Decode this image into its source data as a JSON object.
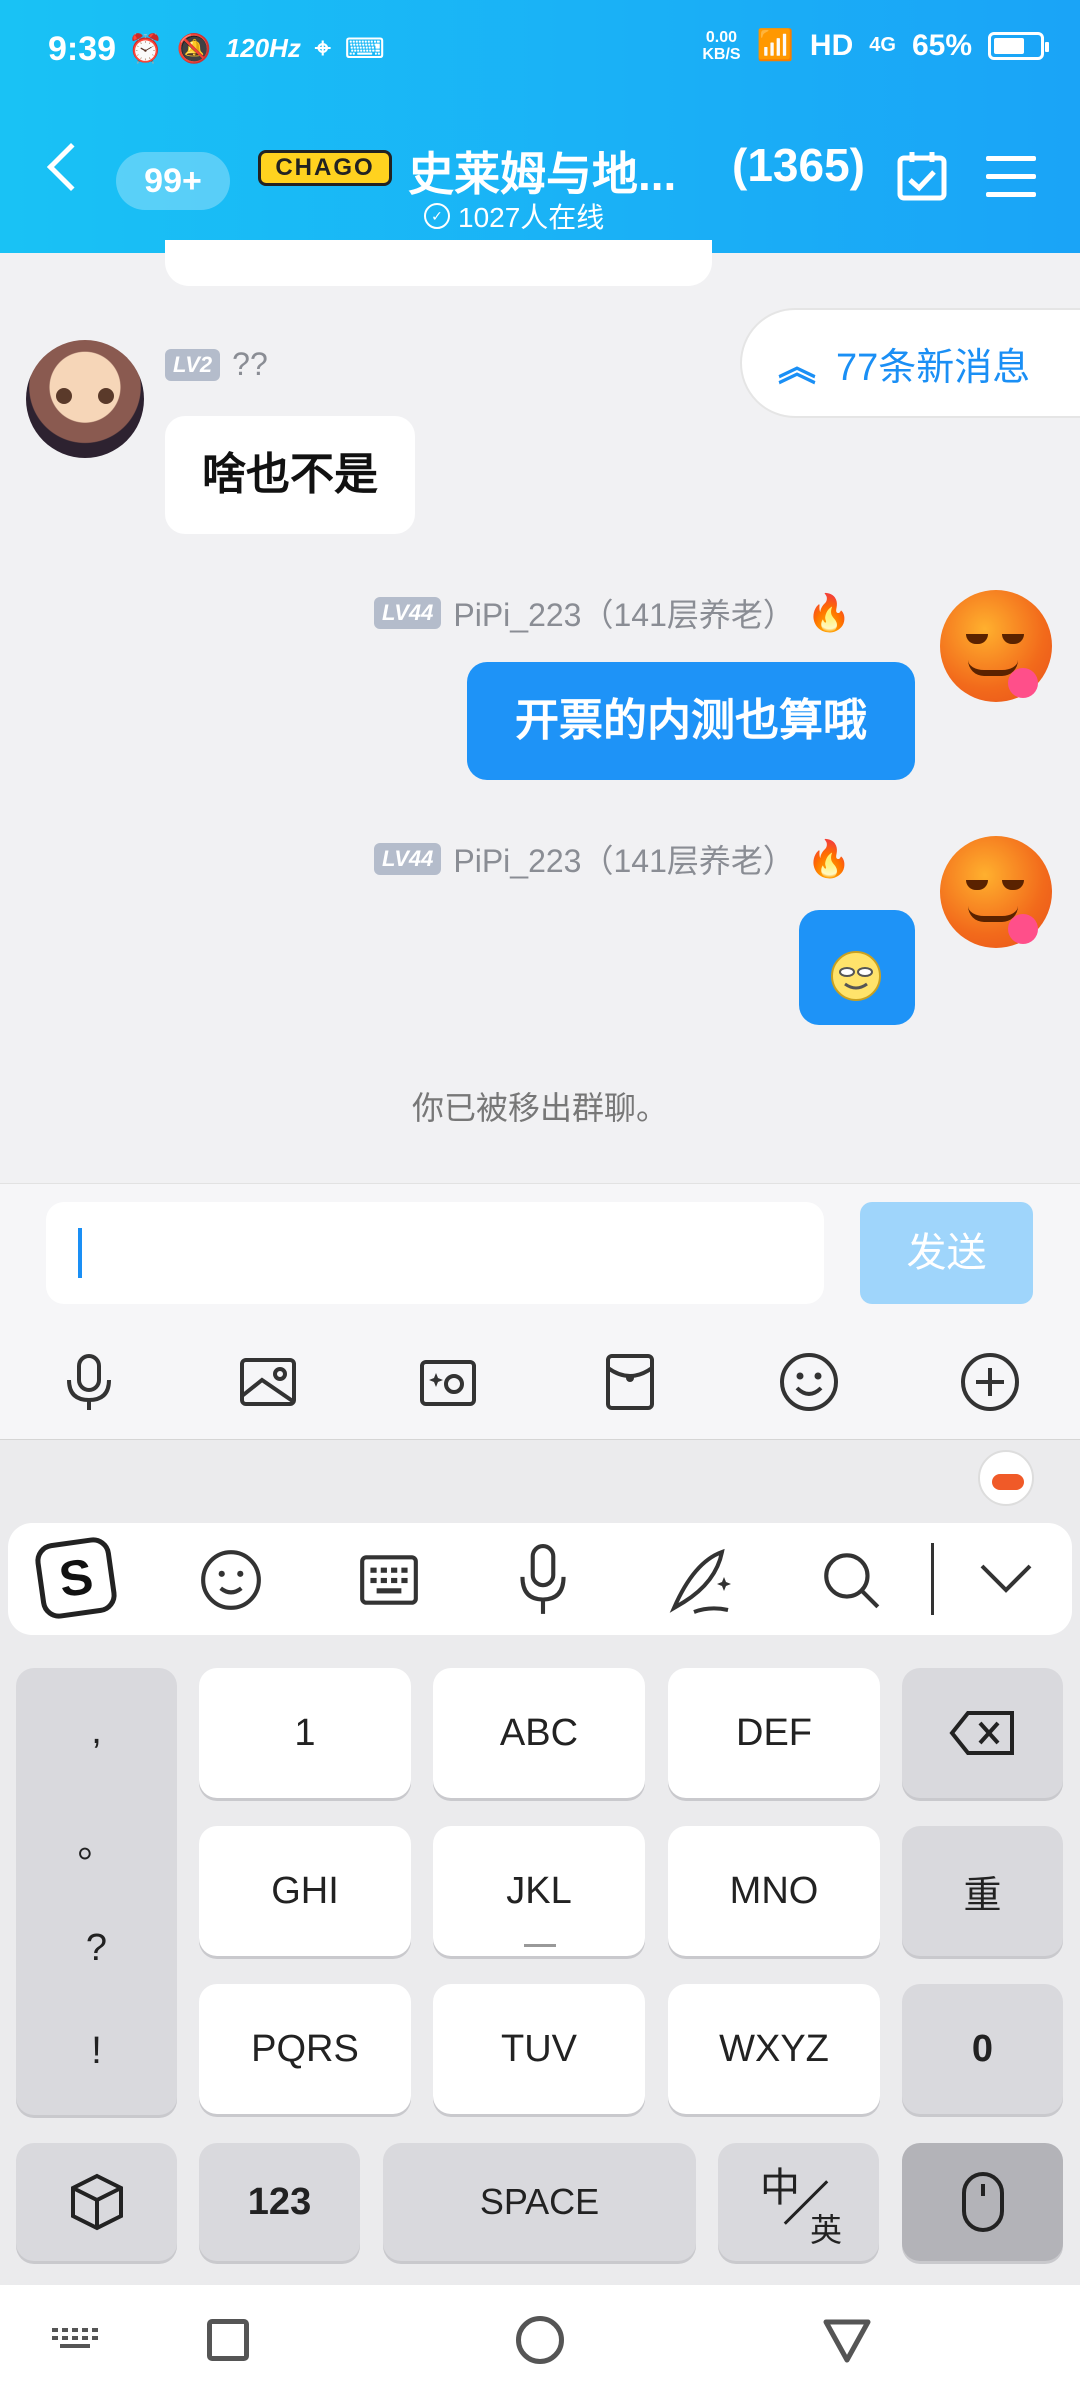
{
  "status": {
    "time": "9:39",
    "refresh": "120Hz",
    "speed_top": "0.00",
    "speed_bottom": "KB/S",
    "network": "HD",
    "signal": "4G",
    "battery": "65%"
  },
  "header": {
    "unread_badge": "99+",
    "logo_text": "CHAGO",
    "group_title": "史莱姆与地...",
    "member_count": "(1365)",
    "online": "1027人在线"
  },
  "chat": {
    "new_messages": "77条新消息",
    "msg1": {
      "level": "LV2",
      "name": "??",
      "text": "啥也不是"
    },
    "msg2": {
      "level": "LV44",
      "name": "PiPi_223（141层养老）",
      "text": "开票的内测也算哦"
    },
    "msg3": {
      "level": "LV44",
      "name": "PiPi_223（141层养老）"
    },
    "system_notice": "你已被移出群聊。"
  },
  "input": {
    "value": "",
    "send_label": "发送"
  },
  "keyboard": {
    "punct": [
      ",",
      "。",
      "?",
      "!"
    ],
    "row1": [
      "1",
      "ABC",
      "DEF"
    ],
    "row2": [
      "GHI",
      "JKL",
      "MNO"
    ],
    "row3": [
      "PQRS",
      "TUV",
      "WXYZ"
    ],
    "redo": "重",
    "zero": "0",
    "num": "123",
    "space": "SPACE",
    "lang_top": "中",
    "lang_bottom": "英"
  },
  "colors": {
    "accent": "#1e93f7",
    "header_start": "#19c2f5",
    "header_end": "#1aa4f7"
  }
}
